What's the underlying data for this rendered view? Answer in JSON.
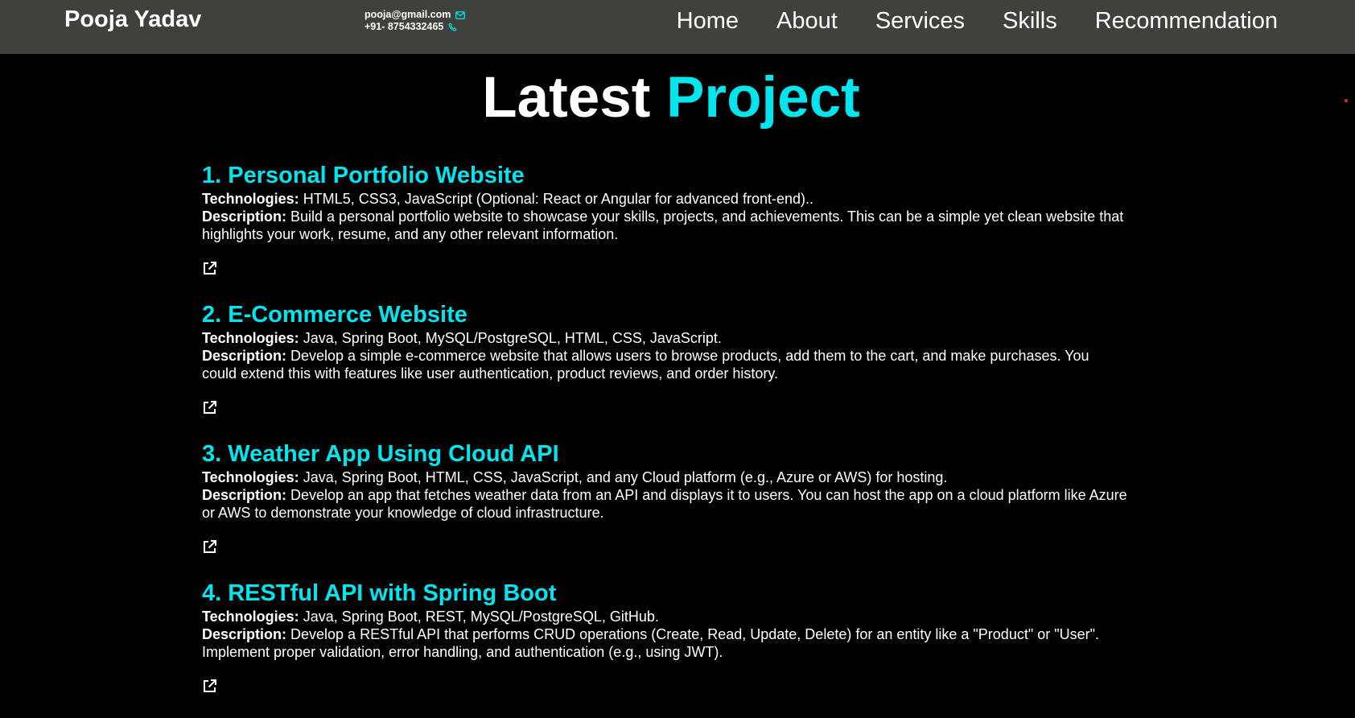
{
  "header": {
    "brand": "Pooja Yadav",
    "email": "pooja@gmail.com",
    "phone": "+91- 8754332465",
    "nav": [
      "Home",
      "About",
      "Services",
      "Skills",
      "Recommendation"
    ]
  },
  "section": {
    "title_part1": "Latest",
    "title_part2": "Project"
  },
  "labels": {
    "technologies": "Technologies:",
    "description": "Description:"
  },
  "projects": [
    {
      "title": "1. Personal Portfolio Website",
      "technologies": " HTML5, CSS3, JavaScript (Optional: React or Angular for advanced front-end)..",
      "description": " Build a personal portfolio website to showcase your skills, projects, and achievements. This can be a simple yet clean website that highlights your work, resume, and any other relevant information."
    },
    {
      "title": "2. E-Commerce Website",
      "technologies": " Java, Spring Boot, MySQL/PostgreSQL, HTML, CSS, JavaScript.",
      "description": " Develop a simple e-commerce website that allows users to browse products, add them to the cart, and make purchases. You could extend this with features like user authentication, product reviews, and order history."
    },
    {
      "title": "3. Weather App Using Cloud API",
      "technologies": " Java, Spring Boot, HTML, CSS, JavaScript, and any Cloud platform (e.g., Azure or AWS) for hosting.",
      "description": " Develop an app that fetches weather data from an API and displays it to users. You can host the app on a cloud platform like Azure or AWS to demonstrate your knowledge of cloud infrastructure."
    },
    {
      "title": "4. RESTful API with Spring Boot",
      "technologies": " Java, Spring Boot, REST, MySQL/PostgreSQL, GitHub.",
      "description": " Develop a RESTful API that performs CRUD operations (Create, Read, Update, Delete) for an entity like a \"Product\" or \"User\". Implement proper validation, error handling, and authentication (e.g., using JWT)."
    }
  ],
  "icons": {
    "email": "envelope-icon",
    "phone": "phone-icon",
    "project_link": "external-link-icon"
  },
  "colors": {
    "accent": "#00e5ee",
    "navbar": "#40413c",
    "background": "#000000"
  }
}
